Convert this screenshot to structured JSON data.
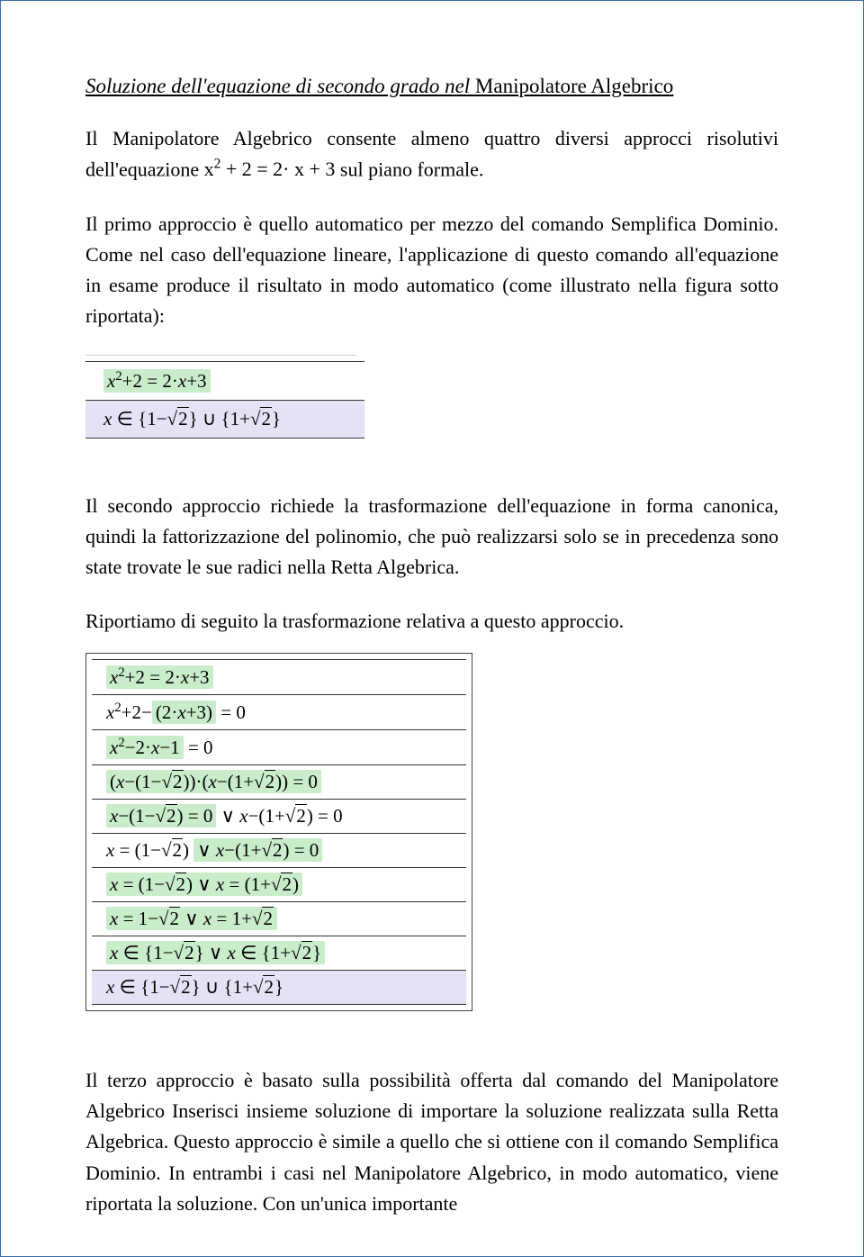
{
  "title_italic": "Soluzione dell'equazione di secondo grado nel ",
  "title_plain": "Manipolatore Algebrico",
  "p1a": "Il Manipolatore Algebrico consente almeno quattro diversi approcci risolutivi dell'equazione ",
  "p1b": " sul piano formale.",
  "equation_main": "x² + 2 = 2·x + 3",
  "p2": "Il primo approccio è quello automatico per mezzo del comando Semplifica Dominio. Come nel caso dell'equazione lineare, l'applicazione di questo comando all'equazione in esame produce il risultato in modo automatico (come illustrato nella figura sotto riportata):",
  "fig1": {
    "line1_a": "x",
    "line1_b": "+2 = 2·",
    "line1_c": "x",
    "line1_d": "+3",
    "line2_a": "x",
    "line2_b": "∈ {1−√2} ∪ {1+√2}"
  },
  "p3": "Il secondo approccio richiede la trasformazione dell'equazione in forma canonica, quindi la fattorizzazione del polinomio, che può realizzarsi solo se in precedenza sono state trovate le sue radici nella Retta Algebrica.",
  "p4": "Riportiamo di seguito la trasformazione relativa a questo approccio.",
  "fig2": {
    "r1": "x²+2 = 2·x+3",
    "r2a": "x²+2−",
    "r2b": "(2·x+3)",
    "r2c": " = 0",
    "r3a": "x²−2·x−1",
    "r3b": " = 0",
    "r4": "(x−(1−√2))·(x−(1+√2)) = 0",
    "r5a": "x−(1−√2) = 0",
    "r5b": " ∨ ",
    "r5c": "x−(1+√2) = 0",
    "r6a": "x = (1−√2)",
    "r6b": " ∨ ",
    "r6c": "x−(1+√2) = 0",
    "r7a": "x = (1−√2)",
    "r7b": " ∨ ",
    "r7c": "x = (1+√2)",
    "r8a": "x = 1−√2",
    "r8b": " ∨ ",
    "r8c": "x = 1+√2",
    "r9a": "x ∈ {1−√2}",
    "r9b": " ∨ ",
    "r9c": "x ∈ {1+√2}",
    "r10": "x ∈ {1−√2} ∪ {1+√2}"
  },
  "p5": "Il terzo approccio è basato sulla possibilità offerta dal comando del Manipolatore Algebrico Inserisci insieme soluzione di importare la soluzione realizzata sulla Retta Algebrica. Questo approccio è simile a quello che si ottiene con il comando Semplifica Dominio. In entrambi i casi nel Manipolatore Algebrico, in modo automatico, viene riportata la soluzione. Con un'unica importante"
}
